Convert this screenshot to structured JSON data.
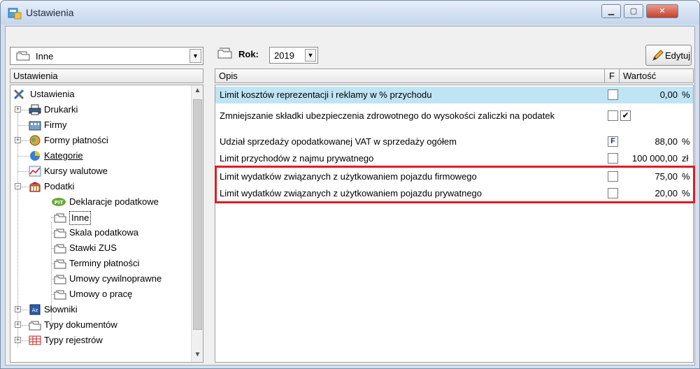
{
  "window": {
    "title": "Ustawienia",
    "controls": {
      "minimize": "▁",
      "maximize": "▢",
      "close": "✕"
    }
  },
  "left": {
    "combo_value": "Inne",
    "header": "Ustawienia",
    "tree": {
      "root": "Ustawienia",
      "drukarki": "Drukarki",
      "firmy": "Firmy",
      "formy": "Formy płatności",
      "kategorie": "Kategorie",
      "kursy": "Kursy walutowe",
      "podatki": "Podatki",
      "deklaracje": "Deklaracje podatkowe",
      "inne": "Inne",
      "skala": "Skala podatkowa",
      "zus": "Stawki ZUS",
      "terminy": "Terminy płatności",
      "cywilno": "Umowy cywilnoprawne",
      "praca": "Umowy o pracę",
      "slowniki": "Słowniki",
      "typy_dok": "Typy dokumentów",
      "typy_rej": "Typy rejestrów"
    }
  },
  "right": {
    "rok_label": "Rok:",
    "rok_value": "2019",
    "edit_label": "Edytuj",
    "headers": {
      "opis": "Opis",
      "f": "F",
      "wartosc": "Wartość"
    },
    "rows": [
      {
        "opis": "Limit kosztów reprezentacji i reklamy w % przychodu",
        "value": "0,00",
        "unit": "%"
      },
      {
        "opis": "Zmniejszanie składki ubezpieczenia zdrowotnego do wysokości zaliczki na podatek",
        "check2": "✔"
      },
      {
        "opis": "Udział sprzedaży opodatkowanej VAT w sprzedaży ogółem",
        "f": "F",
        "value": "88,00",
        "unit": "%"
      },
      {
        "opis": "Limit przychodów z najmu prywatnego",
        "value": "100 000,00",
        "unit": "zł"
      },
      {
        "opis": "Limit wydatków związanych z użytkowaniem pojazdu firmowego",
        "value": "75,00",
        "unit": "%"
      },
      {
        "opis": "Limit wydatków związanych z użytkowaniem pojazdu prywatnego",
        "value": "20,00",
        "unit": "%"
      }
    ]
  }
}
